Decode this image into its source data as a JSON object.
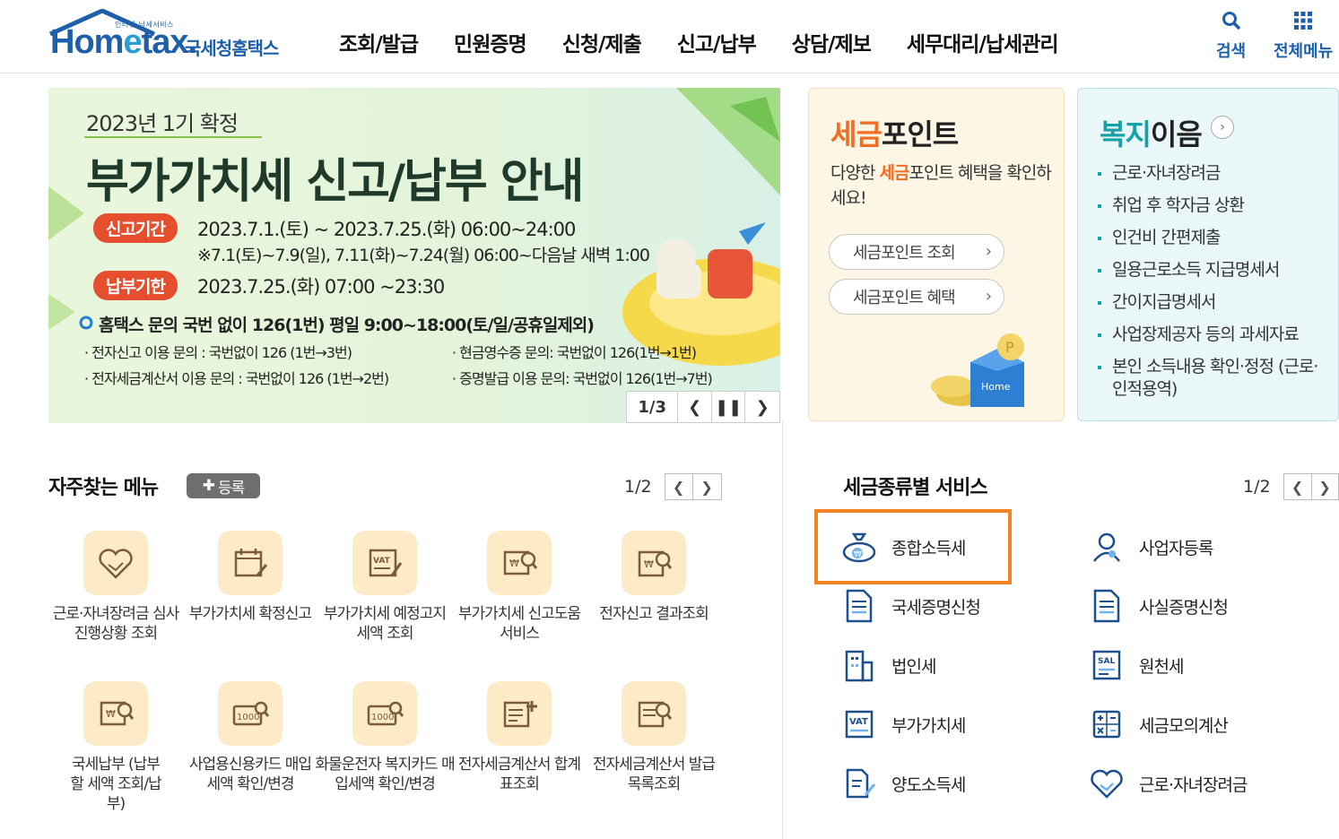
{
  "header": {
    "logo_small": "인터넷 납세서비스",
    "logo_word_a": "Hom",
    "logo_word_e": "e",
    "logo_word_b": "tax.",
    "logo_kr": "국세청홈택스",
    "nav": [
      "조회/발급",
      "민원증명",
      "신청/제출",
      "신고/납부",
      "상담/제보",
      "세무대리/납세관리"
    ],
    "search_label": "검색",
    "allmenu_label": "전체메뉴"
  },
  "banner": {
    "subtitle": "2023년 1기 확정",
    "title": "부가가치세 신고/납부 안내",
    "report_pill": "신고기간",
    "report_period": "2023.7.1.(토) ~ 2023.7.25.(화) 06:00~24:00",
    "report_note": "※7.1(토)~7.9(일), 7.11(화)~7.24(월) 06:00~다음날 새벽 1:00",
    "pay_pill": "납부기한",
    "pay_period": "2023.7.25.(화) 07:00 ~23:30",
    "contact_main": "홈택스 문의 국번 없이 126(1번) 평일 9:00~18:00(토/일/공휴일제외)",
    "contact_1": "· 전자신고 이용 문의 : 국번없이 126 (1번→3번)",
    "contact_2": "· 현금영수증 문의: 국번없이 126(1번→1번)",
    "contact_3": "· 전자세금계산서 이용 문의 : 국번없이 126 (1번→2번)",
    "contact_4": "· 증명발급 이용 문의: 국번없이 126(1번→7번)",
    "slide_index": "1/3",
    "home_badge": "Home"
  },
  "point_card": {
    "title_accent": "세금",
    "title_rest": "포인트",
    "desc_a": "다양한 ",
    "desc_accent": "세금",
    "desc_b": "포인트 혜택을 확인하세요!",
    "btn1": "세금포인트 조회",
    "btn2": "세금포인트 혜택",
    "coin_letter": "P"
  },
  "welfare_card": {
    "title_accent": "복지",
    "title_rest": "이음",
    "items": [
      "근로·자녀장려금",
      "취업 후 학자금 상환",
      "인건비 간편제출",
      "일용근로소득 지급명세서",
      "간이지급명세서",
      "사업장제공자 등의 과세자료",
      "본인 소득내용 확인·정정 (근로·인적용역)"
    ]
  },
  "favorites": {
    "title": "자주찾는 메뉴",
    "register_label": "등록",
    "page": "1/2",
    "items": [
      {
        "label": "근로·자녀장려금 심사진행상황 조회",
        "icon": "heart-hand-icon"
      },
      {
        "label": "부가가치세 확정신고",
        "icon": "calendar-edit-icon"
      },
      {
        "label": "부가가치세 예정고지세액 조회",
        "icon": "vat-edit-icon"
      },
      {
        "label": "부가가치세 신고도움 서비스",
        "icon": "won-search-icon"
      },
      {
        "label": "전자신고 결과조회",
        "icon": "won-doc-search-icon"
      },
      {
        "label": "국세납부 (납부할 세액 조회/납부)",
        "icon": "won-search-icon"
      },
      {
        "label": "사업용신용카드 매입세액 확인/변경",
        "icon": "card-search-icon"
      },
      {
        "label": "화물운전자 복지카드 매입세액 확인/변경",
        "icon": "card-search-icon"
      },
      {
        "label": "전자세금계산서 합계표조회",
        "icon": "invoice-add-icon"
      },
      {
        "label": "전자세금계산서 발급목록조회",
        "icon": "invoice-search-icon"
      }
    ]
  },
  "tax_services": {
    "title": "세금종류별 서비스",
    "page": "1/2",
    "items": [
      {
        "label": "종합소득세",
        "icon": "money-bag-icon",
        "highlighted": true
      },
      {
        "label": "사업자등록",
        "icon": "person-icon"
      },
      {
        "label": "국세증명신청",
        "icon": "document-icon"
      },
      {
        "label": "사실증명신청",
        "icon": "document-icon"
      },
      {
        "label": "법인세",
        "icon": "building-icon"
      },
      {
        "label": "원천세",
        "icon": "sal-doc-icon"
      },
      {
        "label": "부가가치세",
        "icon": "vat-icon"
      },
      {
        "label": "세금모의계산",
        "icon": "calculator-icon"
      },
      {
        "label": "양도소득세",
        "icon": "doc-pen-icon"
      },
      {
        "label": "근로·자녀장려금",
        "icon": "heart-hand-icon"
      }
    ],
    "highlight_color": "#f58220"
  },
  "colors": {
    "brand": "#1d5fa8",
    "accent": "#f06d22",
    "teal": "#14a2a8"
  }
}
